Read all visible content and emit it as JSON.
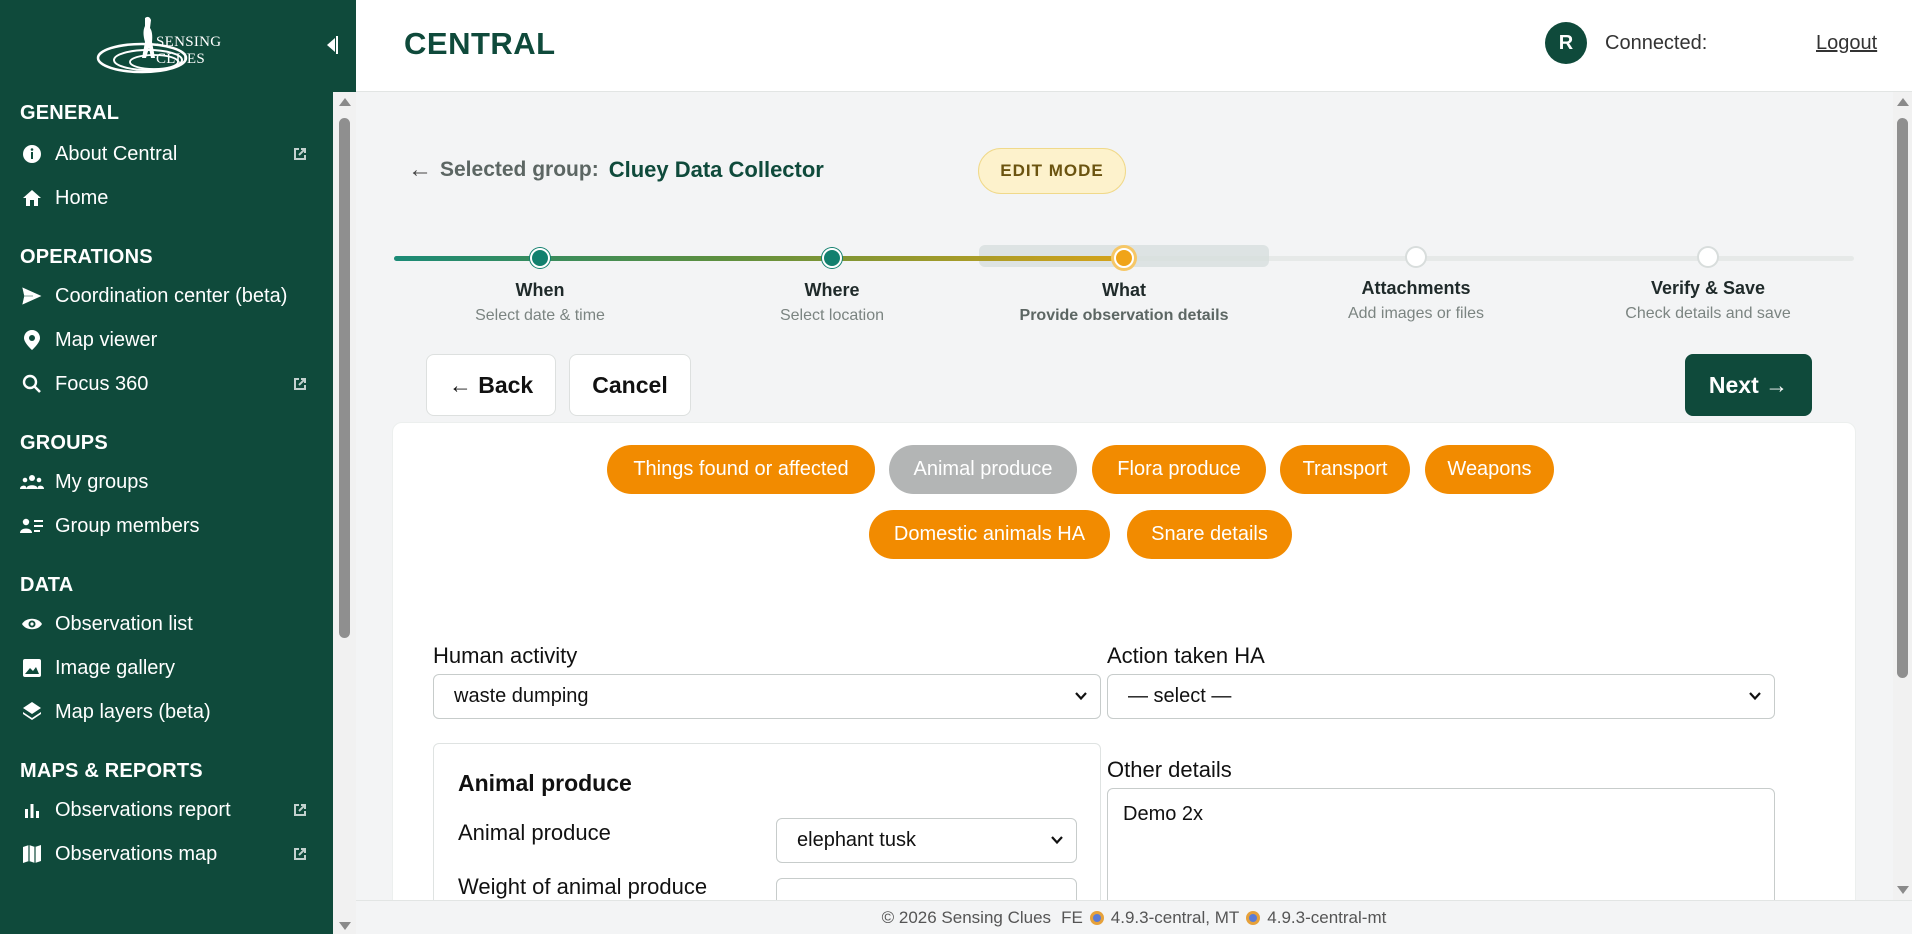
{
  "sidebar": {
    "logo_text": "SENSING CLUES",
    "sections": [
      {
        "title": "GENERAL",
        "items": [
          {
            "label": "About Central",
            "icon": "info-icon",
            "external": true
          },
          {
            "label": "Home",
            "icon": "home-icon",
            "external": false
          }
        ]
      },
      {
        "title": "OPERATIONS",
        "items": [
          {
            "label": "Coordination center (beta)",
            "icon": "send-icon",
            "external": false
          },
          {
            "label": "Map viewer",
            "icon": "map-pin-icon",
            "external": false
          },
          {
            "label": "Focus 360",
            "icon": "search-icon",
            "external": true
          }
        ]
      },
      {
        "title": "GROUPS",
        "items": [
          {
            "label": "My groups",
            "icon": "groups-icon",
            "external": false
          },
          {
            "label": "Group members",
            "icon": "members-icon",
            "external": false
          }
        ]
      },
      {
        "title": "DATA",
        "items": [
          {
            "label": "Observation list",
            "icon": "eye-icon",
            "external": false
          },
          {
            "label": "Image gallery",
            "icon": "image-icon",
            "external": false
          },
          {
            "label": "Map layers (beta)",
            "icon": "layers-icon",
            "external": false
          }
        ]
      },
      {
        "title": "MAPS & REPORTS",
        "items": [
          {
            "label": "Observations report",
            "icon": "bar-chart-icon",
            "external": true
          },
          {
            "label": "Observations map",
            "icon": "map-icon",
            "external": true
          }
        ]
      }
    ]
  },
  "header": {
    "title": "CENTRAL",
    "avatar_initial": "R",
    "connected_label": "Connected:",
    "logout_label": "Logout"
  },
  "selected_group": {
    "arrow": "←",
    "label": "Selected group:",
    "name": "Cluey Data Collector"
  },
  "edit_mode_label": "EDIT MODE",
  "stepper": {
    "progress": 0.5,
    "steps": [
      {
        "title": "When",
        "subtitle": "Select date & time",
        "state": "done"
      },
      {
        "title": "Where",
        "subtitle": "Select location",
        "state": "done"
      },
      {
        "title": "What",
        "subtitle": "Provide observation details",
        "state": "active"
      },
      {
        "title": "Attachments",
        "subtitle": "Add images or files",
        "state": "todo"
      },
      {
        "title": "Verify & Save",
        "subtitle": "Check details and save",
        "state": "todo"
      }
    ]
  },
  "buttons": {
    "back": "← Back",
    "cancel": "Cancel",
    "next": "Next →"
  },
  "categories": [
    {
      "label": "Things found or affected",
      "active": true
    },
    {
      "label": "Animal produce",
      "active": false
    },
    {
      "label": "Flora produce",
      "active": true
    },
    {
      "label": "Transport",
      "active": true
    },
    {
      "label": "Weapons",
      "active": true
    },
    {
      "label": "Domestic animals HA",
      "active": true
    },
    {
      "label": "Snare details",
      "active": true
    }
  ],
  "form": {
    "human_activity": {
      "label": "Human activity",
      "value": "waste dumping"
    },
    "action_taken": {
      "label": "Action taken HA",
      "value": "— select —"
    },
    "animal_produce_section": {
      "title": "Animal produce",
      "field_label": "Animal produce",
      "field_value": "elephant tusk",
      "weight_label": "Weight of animal produce"
    },
    "other_details": {
      "label": "Other details",
      "value": "Demo 2x"
    }
  },
  "footer": {
    "copyright": "© 2026 Sensing Clues",
    "fe_label": "FE",
    "fe_version": "4.9.3-central, MT",
    "mt_version": "4.9.3-central-mt"
  },
  "colors": {
    "brand": "#0f4a3b",
    "accent_orange": "#f28b00",
    "inactive_pill": "#b3b5b5",
    "step_done": "#12806e",
    "step_active": "#f0a418"
  }
}
